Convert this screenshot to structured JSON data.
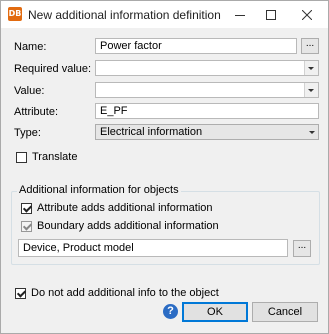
{
  "titlebar": {
    "app_icon_label": "DB",
    "title": "New additional information definition",
    "minimize_icon": "minimize-icon",
    "maximize_icon": "maximize-icon",
    "close_icon": "close-icon"
  },
  "form": {
    "name_label": "Name:",
    "name_value": "Power factor",
    "ellipsis": "...",
    "required_value_label": "Required value:",
    "required_value_value": "",
    "value_label": "Value:",
    "value_value": "",
    "attribute_label": "Attribute:",
    "attribute_value": "E_PF",
    "type_label": "Type:",
    "type_value": "Electrical information",
    "translate_label": "Translate",
    "translate_checked": false
  },
  "group": {
    "title": "Additional information for objects",
    "attribute_adds_label": "Attribute adds additional information",
    "attribute_adds_checked": true,
    "boundary_adds_label": "Boundary adds additional information",
    "boundary_adds_checked": true,
    "objects_value": "Device, Product model",
    "ellipsis": "..."
  },
  "footer": {
    "do_not_add_label": "Do not add additional info to the object",
    "do_not_add_checked": true,
    "help_label": "?",
    "ok_label": "OK",
    "cancel_label": "Cancel"
  },
  "colors": {
    "accent": "#0078d7",
    "app_icon": "#e26b10",
    "help_icon": "#2b6cc4"
  }
}
